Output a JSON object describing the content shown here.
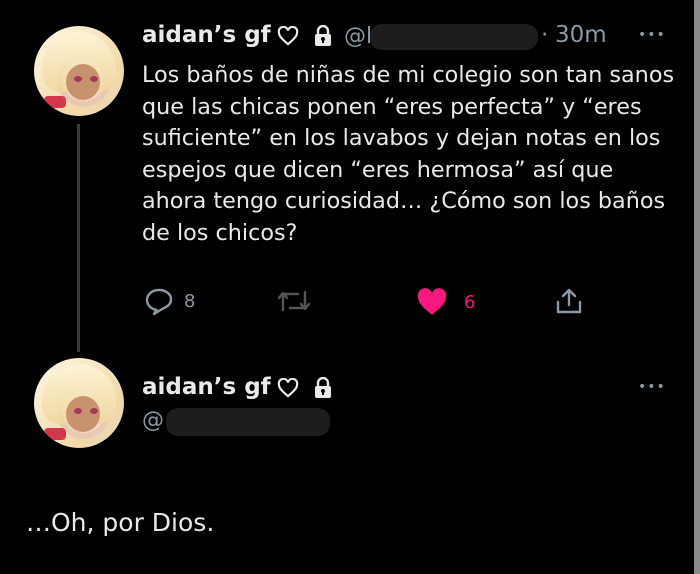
{
  "tweets": [
    {
      "author": "aidan’s gf",
      "handle_prefix": "@l",
      "time": "30m",
      "more": "•••",
      "text": "Los baños de niñas de mi colegio son tan sanos que las chicas ponen “eres perfecta” y “eres suficiente” en los lavabos y dejan notas en los espejos que dicen “eres hermosa” así que ahora tengo curiosidad… ¿Cómo son los baños de los chicos?",
      "actions": {
        "reply_count": "8",
        "retweet_count": "",
        "like_count": "6"
      }
    },
    {
      "author": "aidan’s gf",
      "handle_prefix": "@",
      "more": "•••",
      "text": "…Oh, por Dios."
    }
  ],
  "icons": {
    "heart_outline": "heart-outline-icon",
    "lock": "lock-icon",
    "reply": "reply-icon",
    "retweet": "retweet-icon",
    "like": "like-icon",
    "share": "share-icon",
    "more": "more-icon"
  },
  "colors": {
    "background": "#000000",
    "text": "#e7e9ea",
    "secondary": "#8b98a5",
    "like": "#f91880",
    "redaction": "#1d1d1d"
  }
}
